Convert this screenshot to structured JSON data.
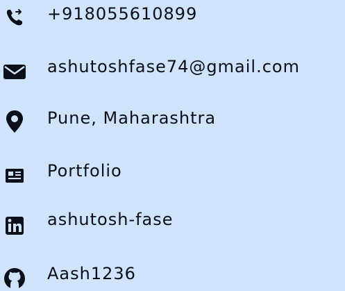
{
  "contact": {
    "items": [
      {
        "icon": "phone-icon",
        "label": "+918055610899"
      },
      {
        "icon": "envelope-icon",
        "label": "ashutoshfase74@gmail.com"
      },
      {
        "icon": "location-pin-icon",
        "label": "Pune, Maharashtra"
      },
      {
        "icon": "portfolio-card-icon",
        "label": "Portfolio"
      },
      {
        "icon": "linkedin-icon",
        "label": "ashutosh-fase"
      },
      {
        "icon": "github-icon",
        "label": "Aash1236"
      }
    ]
  },
  "colors": {
    "background": "#cfe3fb",
    "text": "#0a0f1a",
    "icon": "#0a0f1a"
  }
}
